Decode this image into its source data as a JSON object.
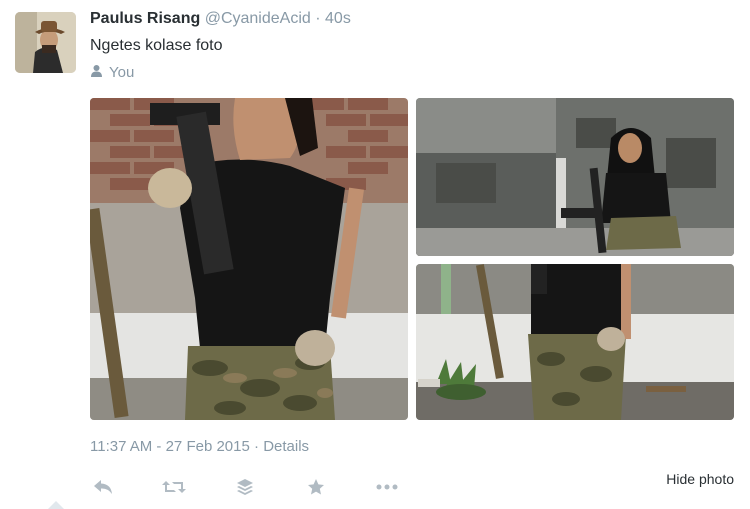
{
  "tweet": {
    "author_name": "Paulus Risang",
    "author_handle": "@CyanideAcid",
    "separator": "·",
    "age": "40s",
    "text": "Ngetes kolase foto",
    "audience": "You",
    "timestamp": "11:37 AM - 27 Feb 2015",
    "details_label": "Details",
    "hide_photo_label": "Hide photo"
  },
  "icons": {
    "audience": "person-icon",
    "reply": "reply-icon",
    "retweet": "retweet-icon",
    "buffer": "layers-icon",
    "favorite": "star-icon",
    "more": "more-icon"
  },
  "colors": {
    "text": "#292f33",
    "muted": "#8899a6",
    "icons": "#b1bbc3"
  }
}
